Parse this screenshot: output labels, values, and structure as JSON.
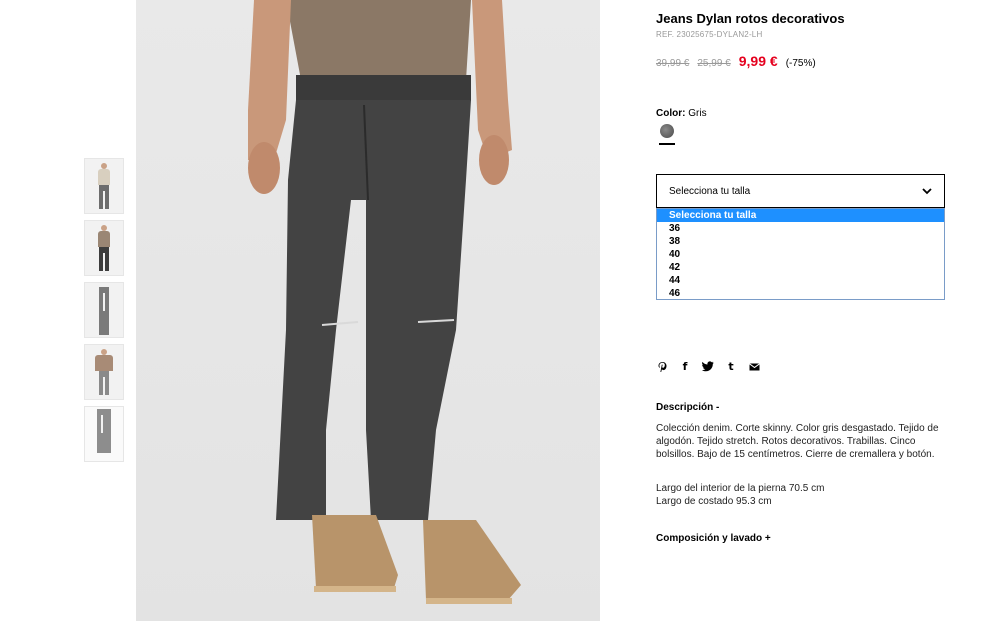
{
  "product": {
    "title": "Jeans Dylan rotos decorativos",
    "ref": "REF. 23025675-DYLAN2-LH",
    "price_original": "39,99 €",
    "price_previous": "25,99 €",
    "price_current": "9,99 €",
    "discount": "(-75%)"
  },
  "color": {
    "label": "Color:",
    "value": "Gris",
    "swatch": "#5c5c5c"
  },
  "size_select": {
    "current": "Selecciona tu talla",
    "options": [
      "Selecciona tu talla",
      "36",
      "38",
      "40",
      "42",
      "44",
      "46"
    ],
    "highlighted": "Selecciona tu talla"
  },
  "share": {
    "icons": [
      "pinterest-icon",
      "facebook-icon",
      "twitter-icon",
      "tumblr-icon",
      "email-icon"
    ],
    "glyphs": [
      "℗",
      "f",
      "♥",
      "t",
      "✉"
    ]
  },
  "description": {
    "title": "Descripción -",
    "body": "Colección denim. Corte skinny. Color gris desgastado. Tejido de algodón. Tejido stretch. Rotos decorativos. Trabillas. Cinco bolsillos. Bajo de 15 centímetros. Cierre de cremallera y botón.",
    "measure_1": "Largo del interior de la pierna 70.5 cm",
    "measure_2": "Largo de costado 95.3 cm"
  },
  "composition": {
    "title": "Composición y lavado +"
  },
  "thumbnails": [
    {
      "torso_color": "#d8cfbf"
    },
    {
      "torso_color": "#9a8674"
    },
    {
      "torso_color": "#e6e6e6"
    },
    {
      "torso_color": "#a88b76"
    },
    {
      "torso_color": "#f2f2f2"
    }
  ],
  "colors": {
    "sale_red": "#e5001e",
    "dropdown_highlight": "#1e90ff"
  }
}
